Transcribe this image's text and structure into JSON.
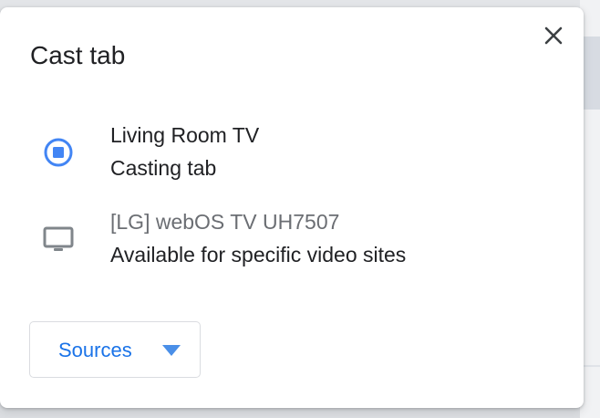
{
  "dialog": {
    "title": "Cast tab",
    "close_icon": "close-icon"
  },
  "sinks": [
    {
      "name": "Living Room TV",
      "status": "Casting tab",
      "icon": "stop-casting-icon",
      "state": "active"
    },
    {
      "name": "[LG] webOS TV UH7507",
      "status": "Available for specific video sites",
      "icon": "tv-icon",
      "state": "available"
    }
  ],
  "sources": {
    "label": "Sources",
    "icon": "dropdown-triangle-icon"
  },
  "colors": {
    "accent": "#1a73e8",
    "active_icon": "#4285f4",
    "muted_text": "#6b6e73",
    "text": "#202124",
    "icon_gray": "#80868b"
  }
}
